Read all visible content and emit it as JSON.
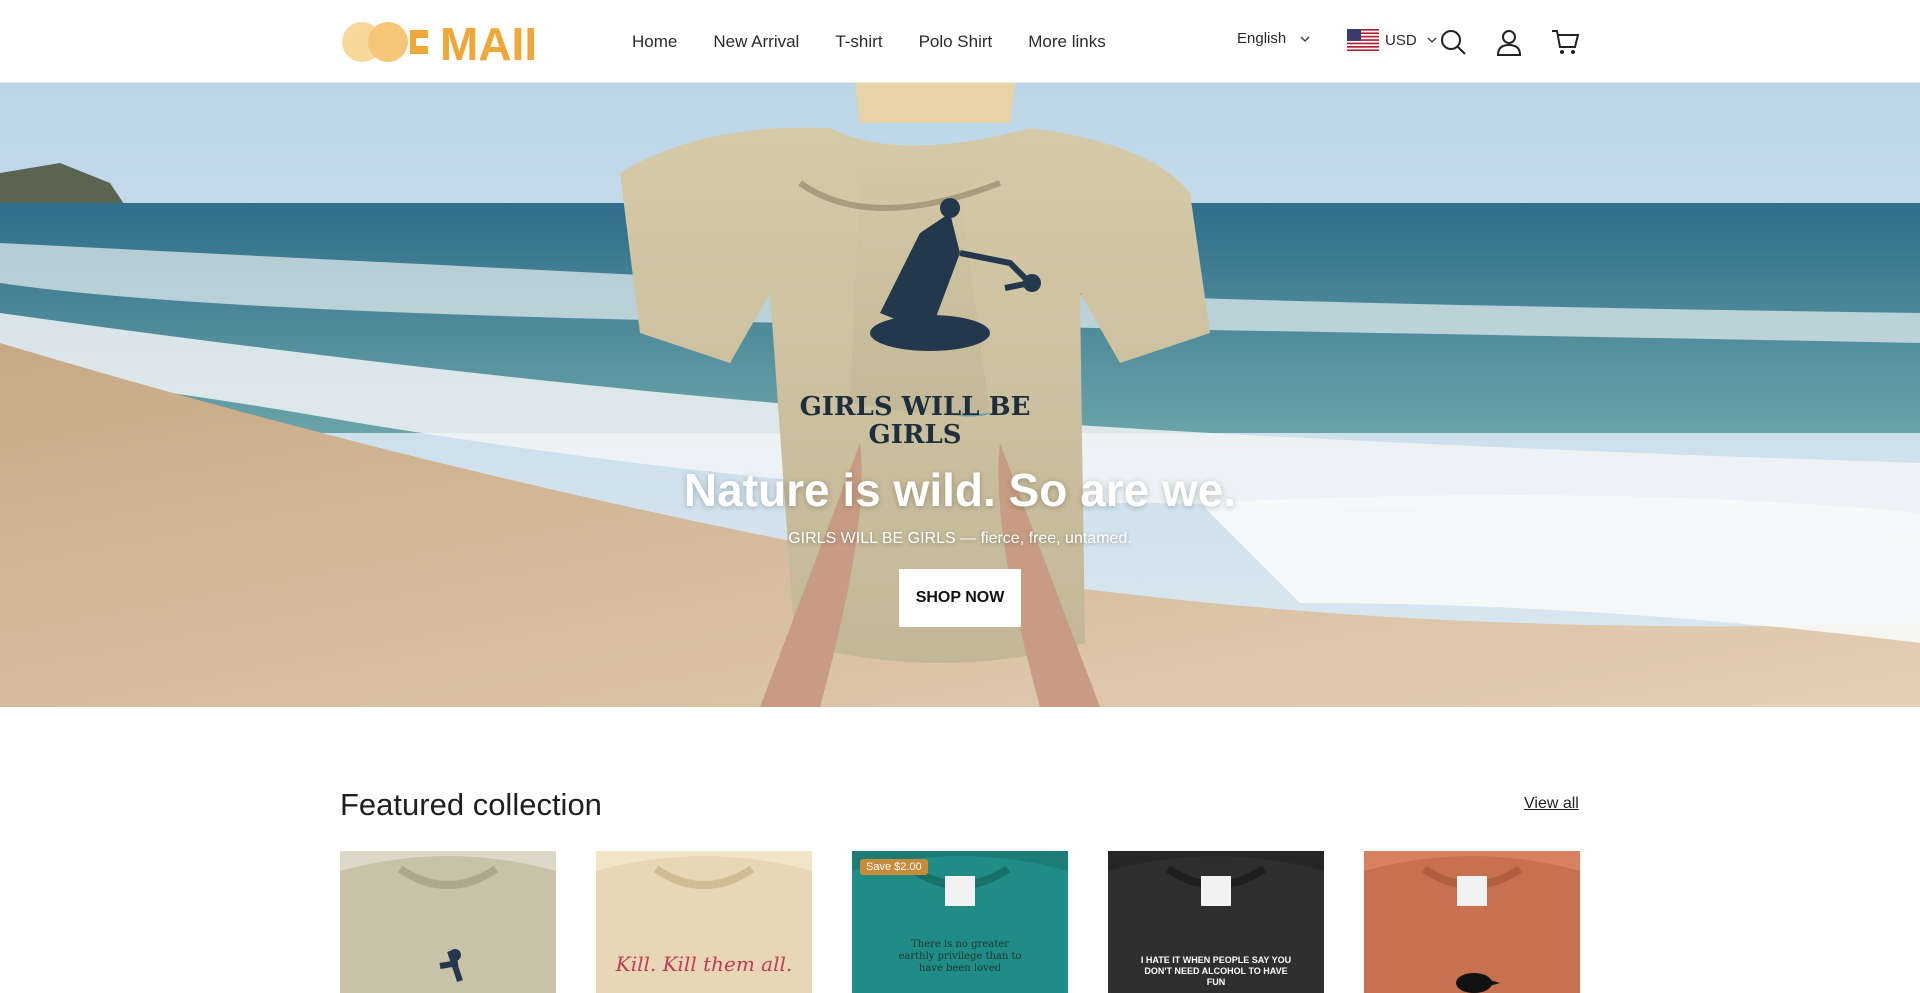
{
  "brand": {
    "logo_text": "MAII"
  },
  "nav": {
    "items": [
      {
        "label": "Home"
      },
      {
        "label": "New Arrival"
      },
      {
        "label": "T-shirt"
      },
      {
        "label": "Polo Shirt"
      },
      {
        "label": "More links"
      }
    ]
  },
  "header": {
    "language": "English",
    "currency": "USD",
    "icons": [
      "search-icon",
      "account-icon",
      "cart-icon"
    ]
  },
  "hero": {
    "shirt_text_line1": "GIRLS WILL BE",
    "shirt_text_line2": "GIRLS",
    "title": "Nature is wild. So are we.",
    "subtitle": "GIRLS WILL BE GIRLS — fierce, free, untamed.",
    "button_label": "SHOP NOW"
  },
  "featured": {
    "title": "Featured collection",
    "view_all": "View all",
    "products": [
      {
        "color": "#c9c2a8",
        "print": "mantis"
      },
      {
        "color": "#e7d7b4",
        "print": "Kill. Kill them all."
      },
      {
        "color": "#1f8c85",
        "print": "There is no greater earthly privilege than to have been loved",
        "badge": "Save $2.00"
      },
      {
        "color": "#2e2e2e",
        "print": "I HATE IT WHEN PEOPLE SAY YOU DON'T NEED ALCOHOL TO HAVE FUN"
      },
      {
        "color": "#c8714f",
        "print": "crow"
      }
    ]
  },
  "colors": {
    "logo_orange": "#f0a73a",
    "logo_light": "#f7cf86",
    "badge": "#c98a3a"
  }
}
